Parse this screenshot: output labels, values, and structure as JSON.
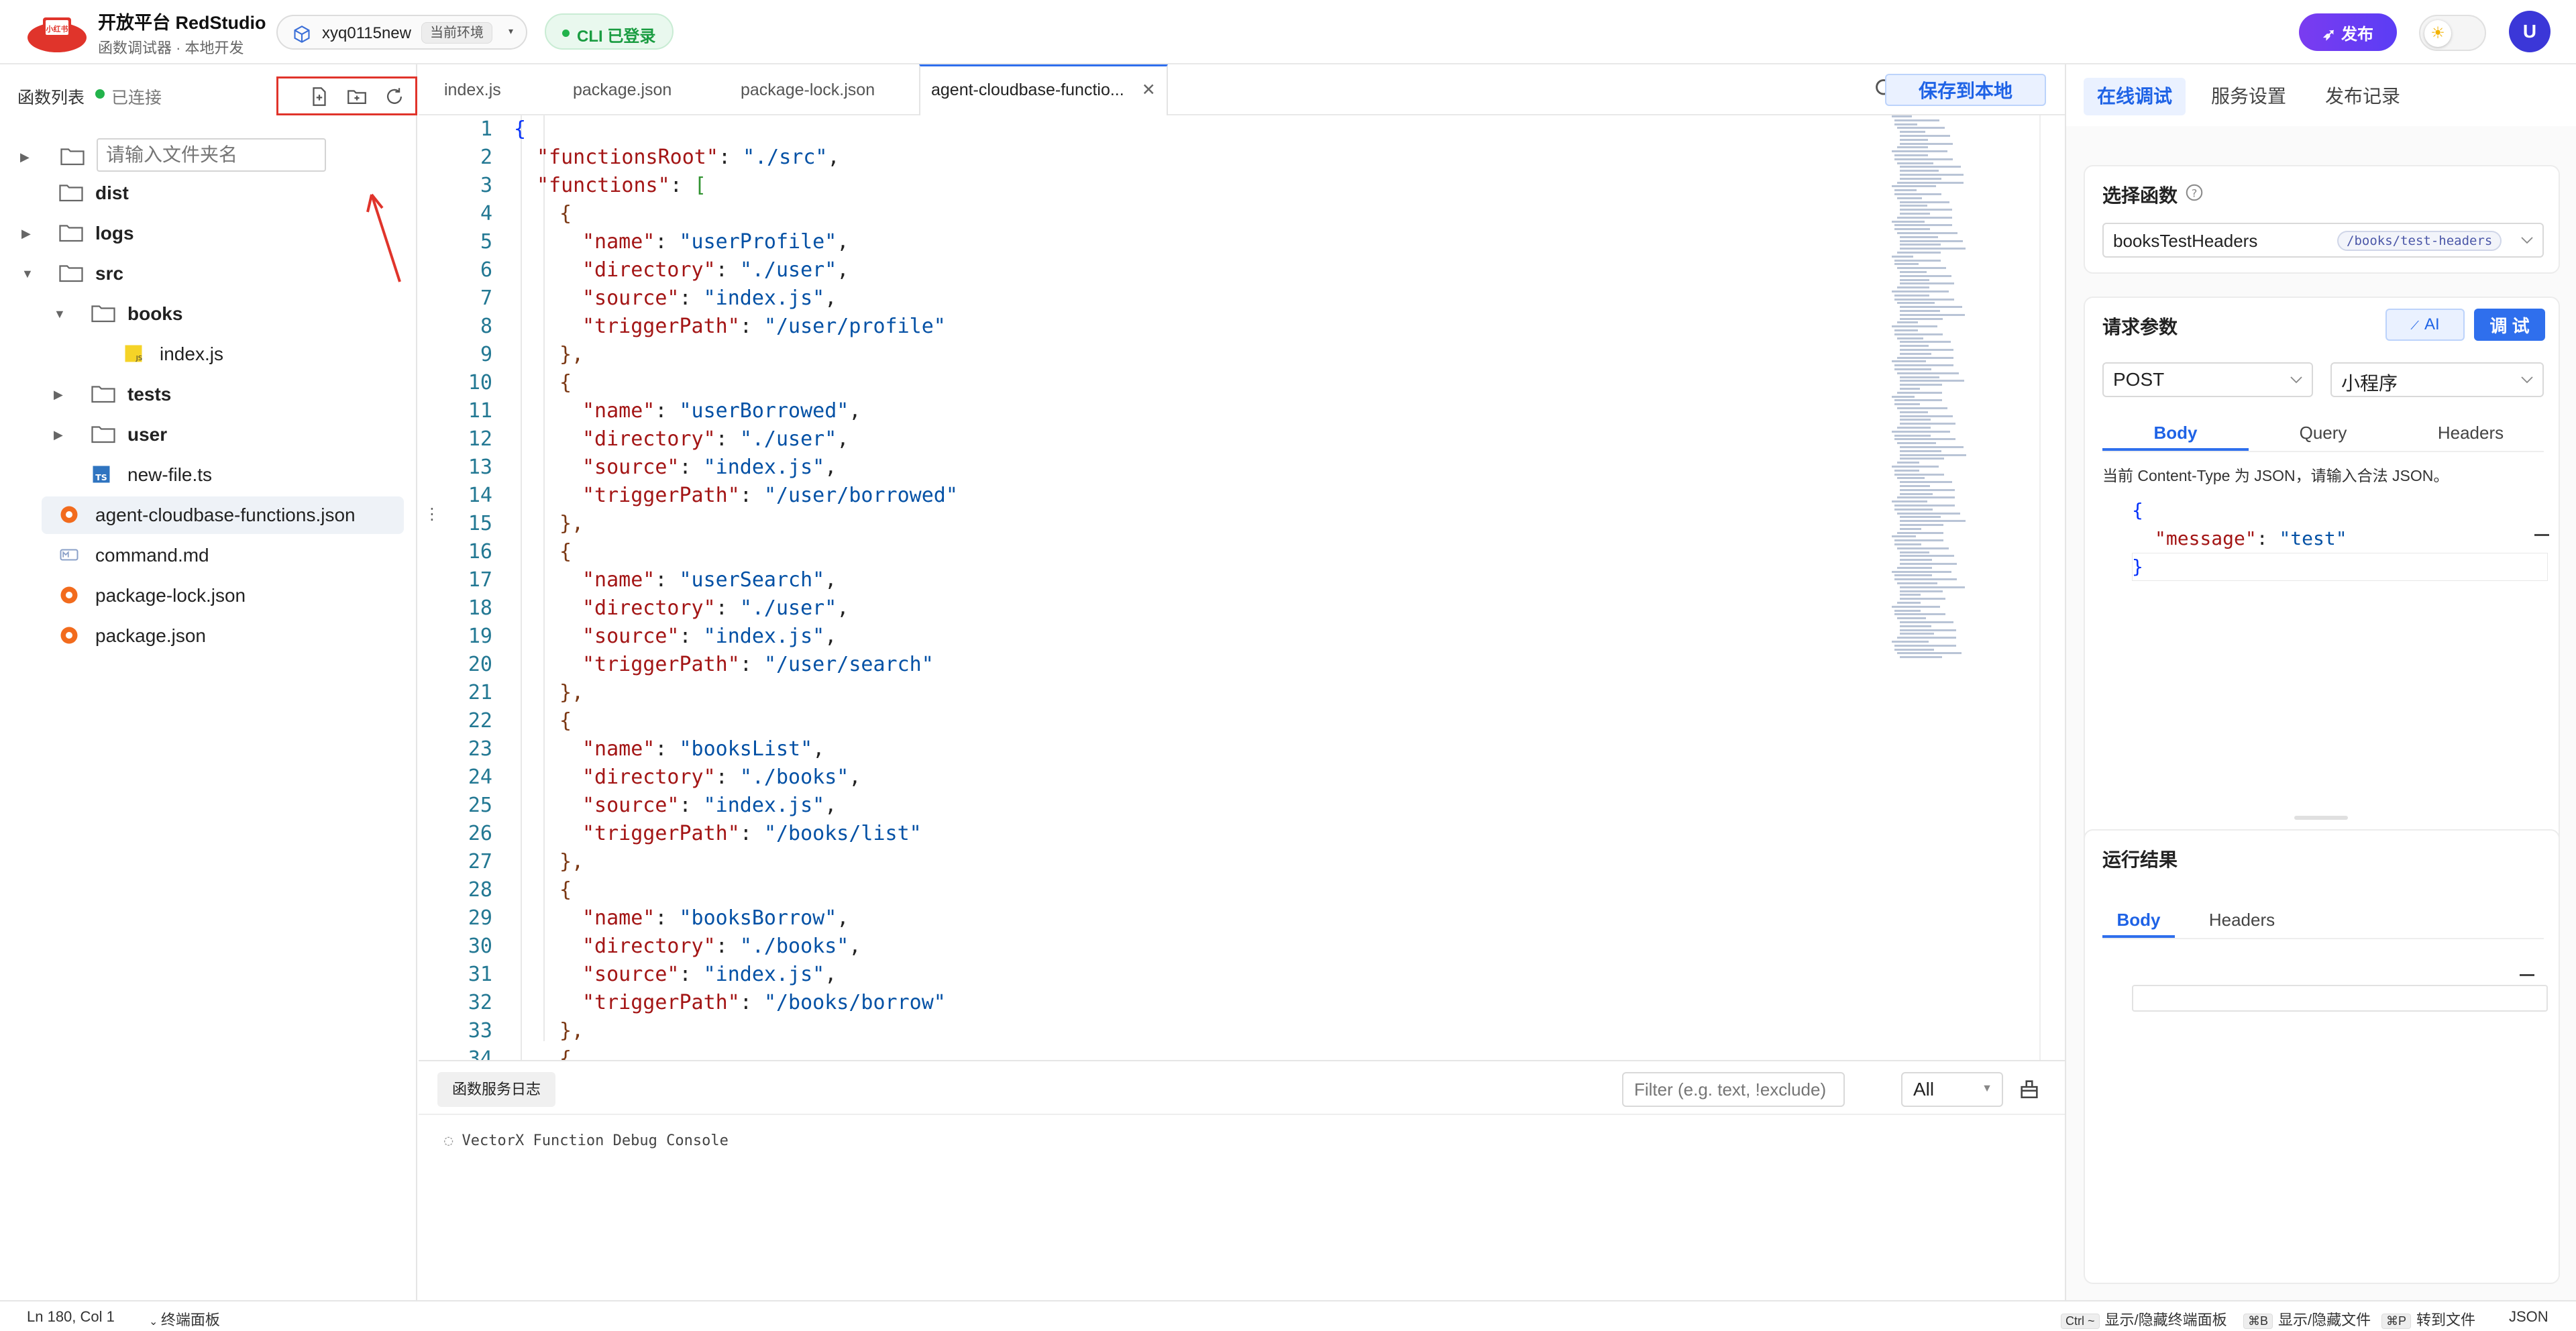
{
  "header": {
    "brand_title": "开放平台 RedStudio",
    "brand_subtitle": "函数调试器 · 本地开发",
    "env_name": "xyq0115new",
    "env_tag": "当前环境",
    "cli_status": "CLI 已登录",
    "publish_label": "发布",
    "avatar_letter": "U",
    "accent_color": "#5b3df5"
  },
  "sidebar": {
    "title": "函数列表",
    "status": "已连接",
    "new_folder_placeholder": "请输入文件夹名",
    "tree": [
      {
        "label": "dist",
        "kind": "folder",
        "depth": 0
      },
      {
        "label": "logs",
        "kind": "folder",
        "depth": 0
      },
      {
        "label": "src",
        "kind": "folder",
        "depth": 0
      },
      {
        "label": "books",
        "kind": "folder",
        "depth": 1
      },
      {
        "label": "index.js",
        "kind": "js",
        "depth": 2
      },
      {
        "label": "tests",
        "kind": "folder",
        "depth": 1
      },
      {
        "label": "user",
        "kind": "folder",
        "depth": 1
      },
      {
        "label": "new-file.ts",
        "kind": "ts",
        "depth": 1
      },
      {
        "label": "agent-cloudbase-functions.json",
        "kind": "json",
        "depth": 0
      },
      {
        "label": "command.md",
        "kind": "md",
        "depth": 0
      },
      {
        "label": "package-lock.json",
        "kind": "json",
        "depth": 0
      },
      {
        "label": "package.json",
        "kind": "json",
        "depth": 0
      }
    ]
  },
  "editor": {
    "tabs": [
      "index.js",
      "package.json",
      "package-lock.json",
      "agent-cloudbase-functio..."
    ],
    "save_label": "保存到本地",
    "line_numbers": [
      "1",
      "2",
      "3",
      "4",
      "5",
      "6",
      "7",
      "8",
      "9",
      "10",
      "11",
      "12",
      "13",
      "14",
      "15",
      "16",
      "17",
      "18",
      "19",
      "20",
      "21",
      "22",
      "23",
      "24",
      "25",
      "26",
      "27",
      "28",
      "29",
      "30",
      "31",
      "32",
      "33",
      "34"
    ],
    "code": {
      "functionsRoot_key": "\"functionsRoot\"",
      "functionsRoot_val": "\"./src\"",
      "functions_key": "\"functions\"",
      "name_key": "\"name\"",
      "directory_key": "\"directory\"",
      "source_key": "\"source\"",
      "triggerPath_key": "\"triggerPath\"",
      "entries": [
        {
          "name": "\"userProfile\"",
          "directory": "\"./user\"",
          "source": "\"index.js\"",
          "triggerPath": "\"/user/profile\""
        },
        {
          "name": "\"userBorrowed\"",
          "directory": "\"./user\"",
          "source": "\"index.js\"",
          "triggerPath": "\"/user/borrowed\""
        },
        {
          "name": "\"userSearch\"",
          "directory": "\"./user\"",
          "source": "\"index.js\"",
          "triggerPath": "\"/user/search\""
        },
        {
          "name": "\"booksList\"",
          "directory": "\"./books\"",
          "source": "\"index.js\"",
          "triggerPath": "\"/books/list\""
        },
        {
          "name": "\"booksBorrow\"",
          "directory": "\"./books\"",
          "source": "\"index.js\"",
          "triggerPath": "\"/books/borrow\""
        }
      ]
    },
    "console_tab": "函数服务日志",
    "filter_placeholder": "Filter (e.g. text, !exclude)",
    "level_value": "All",
    "console_line": "VectorX Function Debug Console"
  },
  "right_panel": {
    "tabs": [
      "在线调试",
      "服务设置",
      "发布记录"
    ],
    "select_fn_title": "选择函数",
    "fn_name": "booksTestHeaders",
    "fn_path": "/books/test-headers",
    "params_title": "请求参数",
    "ai_label": "AI",
    "debug_label": "调 试",
    "method": "POST",
    "client": "小程序",
    "param_tabs": [
      "Body",
      "Query",
      "Headers"
    ],
    "content_type_hint": "当前 Content-Type 为 JSON，请输入合法 JSON。",
    "body_key": "\"message\"",
    "body_value": "\"test\"",
    "result_title": "运行结果",
    "result_tabs": [
      "Body",
      "Headers"
    ]
  },
  "statusbar": {
    "position": "Ln 180, Col 1",
    "terminal": "终端面板",
    "hint1_key": "Ctrl ~",
    "hint1": "显示/隐藏终端面板",
    "hint2_key": "⌘B",
    "hint2": "显示/隐藏文件",
    "hint3_key": "⌘P",
    "hint3": "转到文件",
    "language": "JSON"
  }
}
